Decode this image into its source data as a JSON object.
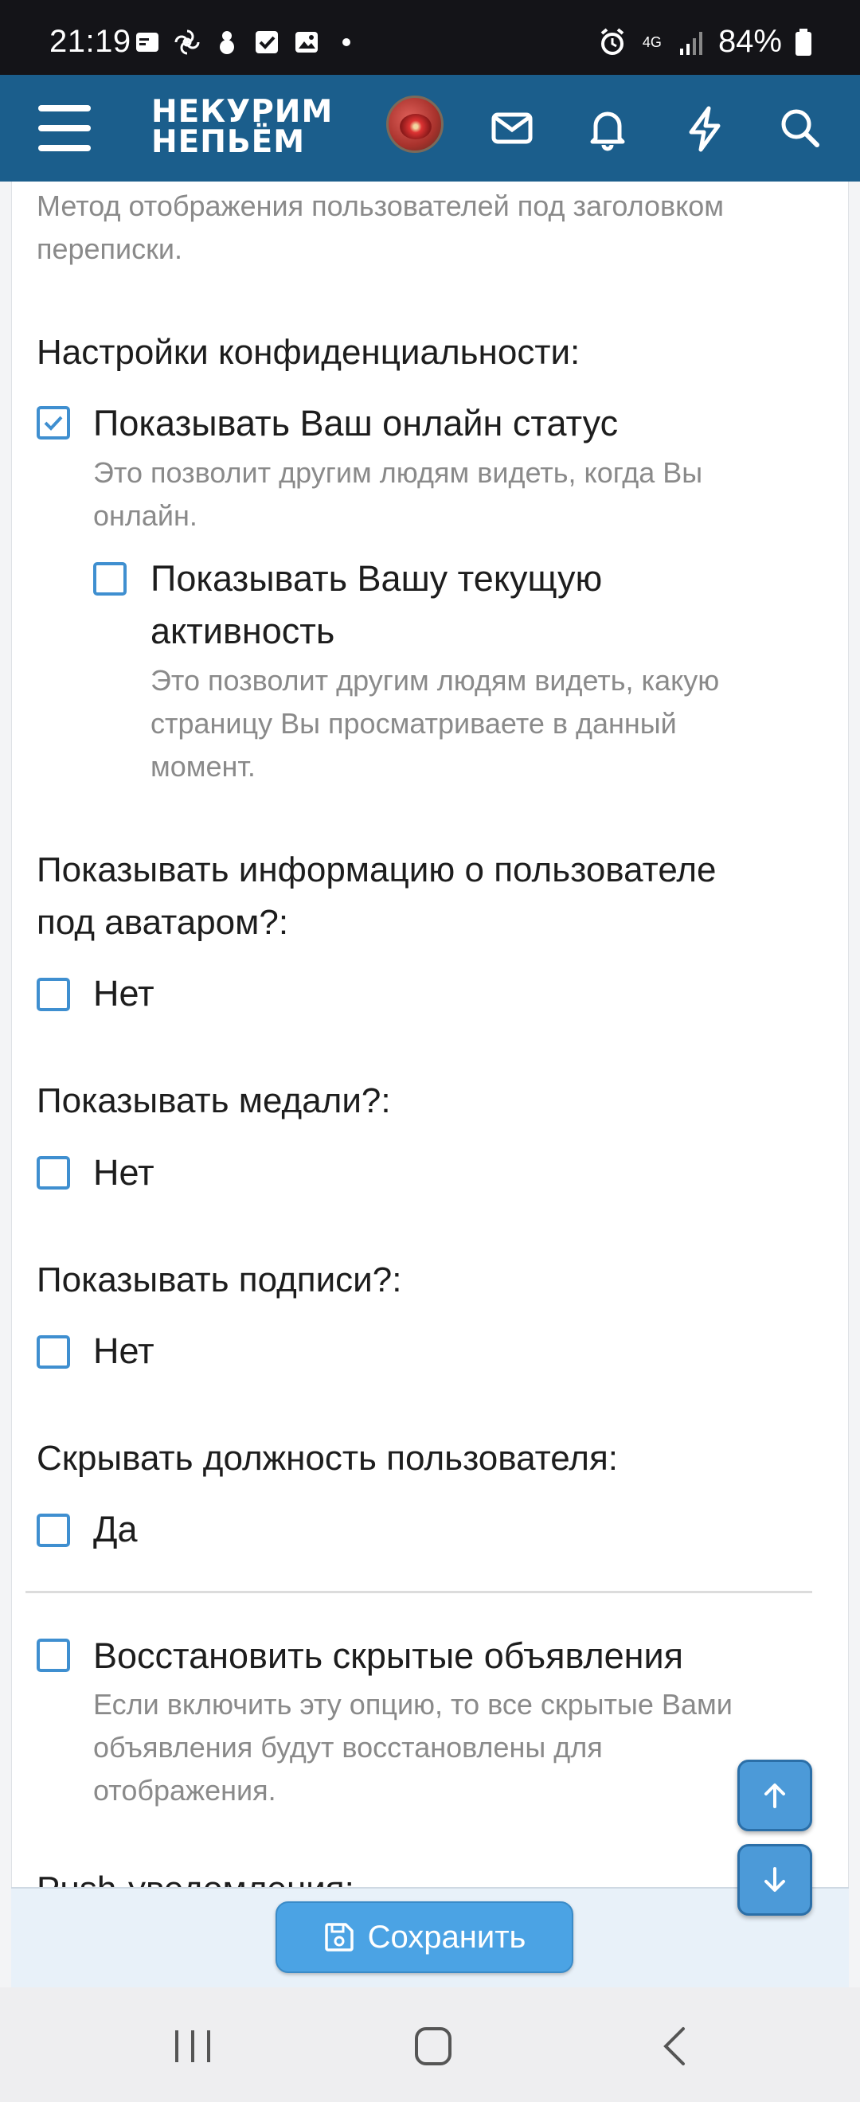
{
  "status_bar": {
    "time": "21:19",
    "network": "4G",
    "battery": "84%"
  },
  "app_bar": {
    "logo_line1": "НЕКУРИМ",
    "logo_line2": "НЕПЬЁМ"
  },
  "content": {
    "intro_hint": "Метод отображения пользователей под заголовком переписки.",
    "privacy": {
      "heading": "Настройки конфиденциальности:",
      "online_status": {
        "label": "Показывать Ваш онлайн статус",
        "hint_line1": "Это позволит другим людям видеть, когда Вы",
        "hint_line2": "онлайн.",
        "checked": true
      },
      "activity": {
        "label_line1": "Показывать Вашу текущую",
        "label_line2": "активность",
        "hint_line1": "Это позволит другим людям видеть, какую",
        "hint_line2": "страницу Вы просматриваете в данный",
        "hint_line3": "момент.",
        "checked": false
      }
    },
    "avatar_info": {
      "heading_line1": "Показывать информацию о пользователе",
      "heading_line2": "под аватаром?:",
      "option": "Нет"
    },
    "medals": {
      "heading": "Показывать медали?:",
      "option": "Нет"
    },
    "signatures": {
      "heading": "Показывать подписи?:",
      "option": "Нет"
    },
    "hide_title": {
      "heading": "Скрывать должность пользователя:",
      "option": "Да"
    },
    "restore_notices": {
      "label": "Восстановить скрытые объявления",
      "hint_line1": "Если включить эту опцию, то все скрытые Вами",
      "hint_line2": "объявления будут восстановлены для",
      "hint_line3": "отображения."
    },
    "next_heading_partial": "Push-уведомления:"
  },
  "footer": {
    "save_label": "Сохранить"
  },
  "colors": {
    "app_bar": "#1b5e8c",
    "accent": "#4ba3e4",
    "checkbox_border": "#3f8fd0"
  }
}
